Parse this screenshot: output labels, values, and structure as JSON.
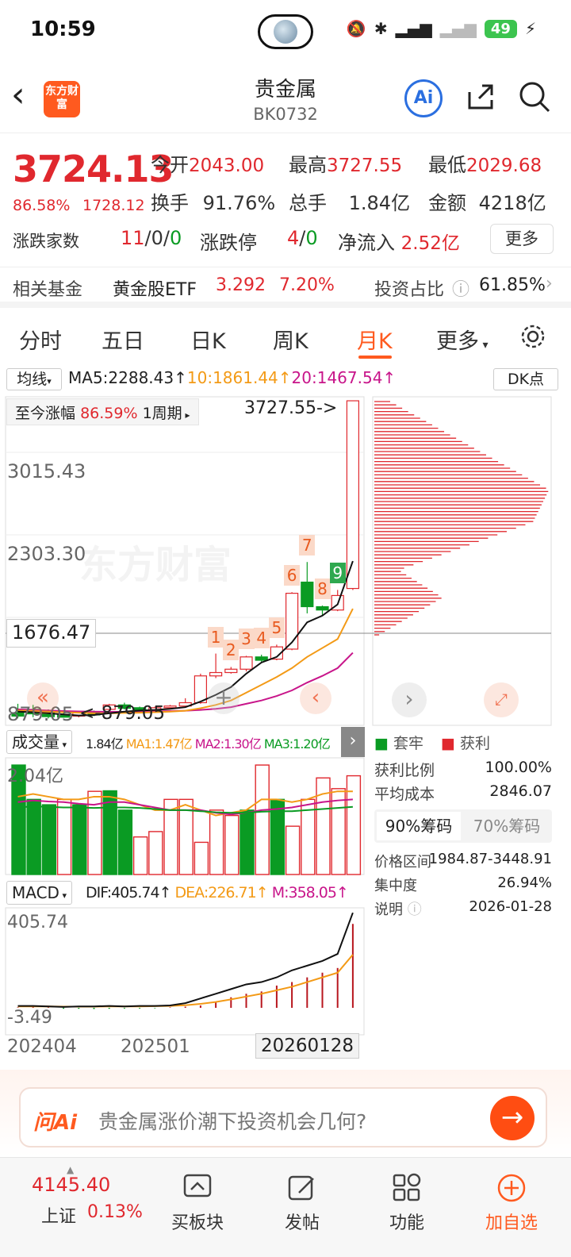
{
  "status": {
    "time": "10:59",
    "battery": "49"
  },
  "header": {
    "title": "贵金属",
    "code": "BK0732",
    "logo": "东方财富",
    "ai": "Ai"
  },
  "quote": {
    "price": "3724.13",
    "pct": "86.58%",
    "change": "1728.12",
    "open_label": "今开",
    "open": "2043.00",
    "high_label": "最高",
    "high": "3727.55",
    "low_label": "最低",
    "low": "2029.68",
    "turnover_label": "换手",
    "turnover": "91.76%",
    "vol_label": "总手",
    "vol": "1.84亿",
    "amount_label": "金额",
    "amount": "4218亿",
    "updown_label": "涨跌家数",
    "up": "11",
    "flat": "0",
    "down": "0",
    "limit_label": "涨跌停",
    "limit_up": "4",
    "limit_down": "0",
    "inflow_label": "净流入",
    "inflow": "2.52亿",
    "more": "更多"
  },
  "fund": {
    "label": "相关基金",
    "name": "黄金股ETF",
    "price": "3.292",
    "pct": "7.20%",
    "ratio_label": "投资占比",
    "ratio": "61.85%"
  },
  "tabs": [
    "分时",
    "五日",
    "日K",
    "周K",
    "月K",
    "更多"
  ],
  "active_tab": "月K",
  "kline": {
    "ma_label": "均线",
    "ma5": "MA5:2288.43↑",
    "ma10": "10:1861.44↑",
    "ma20": "20:1467.54↑",
    "dk": "DK点",
    "since_label": "至今涨幅",
    "since_pct": "86.59%",
    "period": "1周期",
    "high_mark": "3727.55->",
    "low_mark": "<-879.05",
    "y_labels": [
      "3015.43",
      "2303.30",
      "1676.47",
      "879.05"
    ],
    "watermark": "东方财富",
    "seq": [
      "1",
      "2",
      "3",
      "4",
      "5",
      "6",
      "7",
      "8",
      "9"
    ]
  },
  "chart_data": [
    {
      "type": "candlestick",
      "title": "月K",
      "y_ticks": [
        3015.43,
        2303.3,
        879.05
      ],
      "crosshair": 1676.47,
      "candles": [
        {
          "o": 930,
          "c": 900,
          "h": 1010,
          "l": 880
        },
        {
          "o": 960,
          "c": 920,
          "h": 1000,
          "l": 890
        },
        {
          "o": 935,
          "c": 895,
          "h": 960,
          "l": 879.05
        },
        {
          "o": 915,
          "c": 890,
          "h": 930,
          "l": 885
        },
        {
          "o": 900,
          "c": 930,
          "h": 945,
          "l": 888
        },
        {
          "o": 930,
          "c": 910,
          "h": 950,
          "l": 900
        },
        {
          "o": 960,
          "c": 1000,
          "h": 1010,
          "l": 950
        },
        {
          "o": 1000,
          "c": 970,
          "h": 1020,
          "l": 960
        },
        {
          "o": 975,
          "c": 940,
          "h": 985,
          "l": 930
        },
        {
          "o": 940,
          "c": 975,
          "h": 985,
          "l": 935
        },
        {
          "o": 975,
          "c": 990,
          "h": 1000,
          "l": 960
        },
        {
          "o": 990,
          "c": 1020,
          "h": 1060,
          "l": 980
        },
        {
          "o": 1020,
          "c": 1260,
          "h": 1280,
          "l": 1010
        },
        {
          "o": 1260,
          "c": 1290,
          "h": 1460,
          "l": 1240
        },
        {
          "o": 1290,
          "c": 1320,
          "h": 1340,
          "l": 1280
        },
        {
          "o": 1320,
          "c": 1430,
          "h": 1440,
          "l": 1300
        },
        {
          "o": 1430,
          "c": 1400,
          "h": 1450,
          "l": 1380
        },
        {
          "o": 1410,
          "c": 1520,
          "h": 1540,
          "l": 1400
        },
        {
          "o": 1500,
          "c": 2000,
          "h": 2010,
          "l": 1490
        },
        {
          "o": 2100,
          "c": 1880,
          "h": 2280,
          "l": 1820
        },
        {
          "o": 1880,
          "c": 1850,
          "h": 1890,
          "l": 1800
        },
        {
          "o": 1850,
          "c": 1980,
          "h": 2030,
          "l": 1840
        },
        {
          "o": 2043,
          "c": 3724.13,
          "h": 3727.55,
          "l": 2029.68
        }
      ],
      "ma5": [
        940,
        935,
        925,
        915,
        905,
        910,
        925,
        940,
        950,
        955,
        965,
        980,
        1030,
        1090,
        1160,
        1280,
        1380,
        1430,
        1560,
        1740,
        1800,
        1900,
        2288.43
      ],
      "ma10": [
        950,
        945,
        940,
        935,
        930,
        925,
        925,
        928,
        930,
        935,
        940,
        948,
        970,
        1000,
        1040,
        1110,
        1180,
        1250,
        1330,
        1430,
        1510,
        1590,
        1861.44
      ],
      "ma20": [
        960,
        955,
        950,
        945,
        942,
        940,
        938,
        938,
        940,
        942,
        945,
        948,
        955,
        965,
        980,
        1010,
        1040,
        1080,
        1130,
        1200,
        1260,
        1330,
        1467.54
      ]
    },
    {
      "type": "bar",
      "title": "成交量",
      "label": "成交量",
      "vol": "1.84亿",
      "ma1": "MA1:1.47亿",
      "ma2": "MA2:1.30亿",
      "ma3": "MA3:1.20亿",
      "y_ticks": [
        "2.04亿"
      ],
      "values": [
        2.04,
        1.4,
        1.3,
        1.4,
        1.3,
        1.55,
        1.56,
        1.2,
        0.7,
        0.8,
        1.4,
        1.4,
        0.6,
        1.2,
        1.1,
        1.2,
        2.04,
        1.4,
        0.9,
        1.4,
        1.8,
        1.6,
        1.84
      ],
      "up": [
        false,
        false,
        false,
        true,
        false,
        true,
        false,
        false,
        true,
        true,
        true,
        true,
        true,
        true,
        true,
        false,
        true,
        false,
        true,
        true,
        true,
        true,
        true
      ]
    },
    {
      "type": "bar",
      "title": "MACD",
      "label": "MACD",
      "dif": "DIF:405.74↑",
      "dea": "DEA:226.71↑",
      "m": "M:358.05↑",
      "y_ticks": [
        405.74,
        -3.49
      ],
      "x_ticks": [
        "202404",
        "202501",
        "20260128"
      ]
    }
  ],
  "chips": {
    "legend_trap": "套牢",
    "legend_profit": "获利",
    "profit_ratio_label": "获利比例",
    "profit_ratio": "100.00%",
    "avg_cost_label": "平均成本",
    "avg_cost": "2846.07",
    "tab90": "90%筹码",
    "tab70": "70%筹码",
    "range_label": "价格区间",
    "range": "1984.87-3448.91",
    "conc_label": "集中度",
    "conc": "26.94%",
    "note_label": "说明",
    "date": "2026-01-28"
  },
  "ask": {
    "brand": "问Ai",
    "question": "贵金属涨价潮下投资机会几何?"
  },
  "bottom": {
    "index_val": "4145.40",
    "index_name": "上证",
    "index_pct": "0.13%",
    "nav": [
      "买板块",
      "发帖",
      "功能",
      "加自选"
    ]
  }
}
